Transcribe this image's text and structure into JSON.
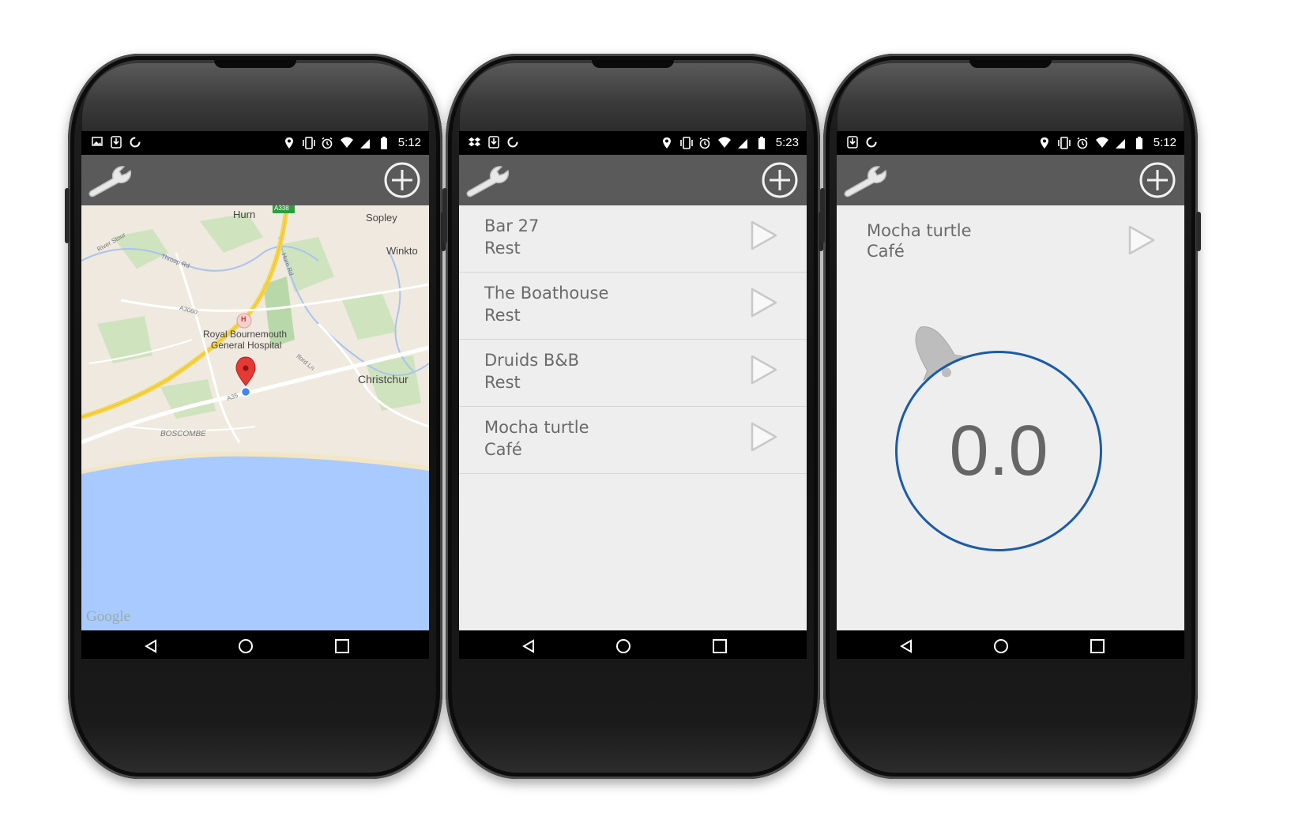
{
  "phones": [
    {
      "screen": "map",
      "status": {
        "time": "5:12",
        "left_icons": [
          "image-icon",
          "download-icon",
          "sync-icon"
        ]
      },
      "map": {
        "labels": [
          "Hurn",
          "Sopley",
          "Winkto",
          "Royal Bournemouth",
          "General Hospital",
          "Christchur",
          "BOSCOMBE",
          "A338",
          "Throop Rd",
          "River Stour",
          "A3060",
          "Hurn Rd",
          "A35",
          "Iford Ln",
          "H"
        ],
        "attribution": "Google"
      }
    },
    {
      "screen": "list",
      "status": {
        "time": "5:23",
        "left_icons": [
          "dropbox-icon",
          "download-icon",
          "sync-icon"
        ]
      },
      "list": [
        {
          "name": "Bar 27",
          "type": "Rest"
        },
        {
          "name": "The Boathouse",
          "type": "Rest"
        },
        {
          "name": "Druids B&B",
          "type": "Rest"
        },
        {
          "name": "Mocha turtle",
          "type": "Café"
        }
      ]
    },
    {
      "screen": "meter",
      "status": {
        "time": "5:12",
        "left_icons": [
          "download-icon",
          "sync-icon"
        ]
      },
      "meter": {
        "name": "Mocha turtle",
        "type": "Café",
        "value": "0.0"
      }
    }
  ],
  "colors": {
    "actionbar": "#5a5a5a",
    "content": "#eeeeee",
    "gauge_ring": "#1a5ba8",
    "water": "#a8caff",
    "land": "#efe9df"
  },
  "icons": [
    "wrench-icon",
    "add-circle-icon",
    "play-icon",
    "bell-icon",
    "location-icon",
    "vibrate-icon",
    "alarm-icon",
    "wifi-icon",
    "signal-icon",
    "battery-icon",
    "back-icon",
    "home-icon",
    "recents-icon"
  ]
}
